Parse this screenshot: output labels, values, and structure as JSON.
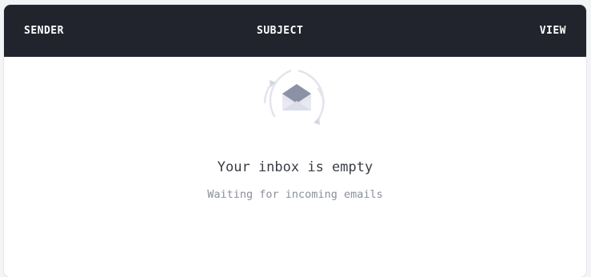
{
  "table": {
    "columns": {
      "sender": "SENDER",
      "subject": "SUBJECT",
      "view": "VIEW"
    }
  },
  "empty_state": {
    "icon": "envelope-refresh-icon",
    "title": "Your inbox is empty",
    "subtitle": "Waiting for incoming emails"
  },
  "colors": {
    "header_bg": "#21242d",
    "header_text": "#ffffff",
    "icon_ring": "#e3e4ec",
    "envelope": "#8b92a6"
  }
}
